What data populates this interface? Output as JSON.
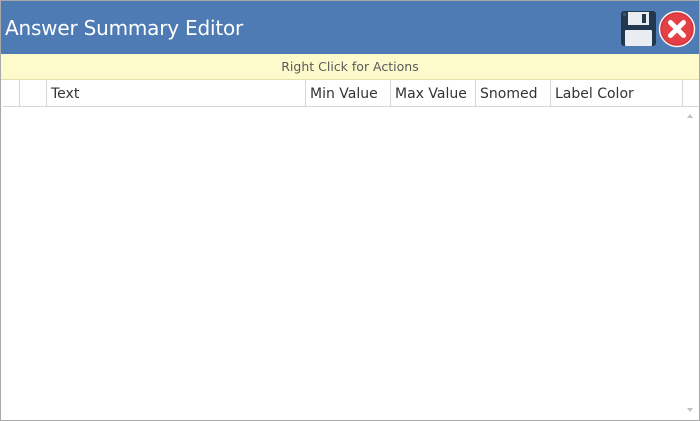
{
  "window": {
    "title": "Answer Summary Editor"
  },
  "toolbar": {
    "save_icon": "floppy-disk-icon",
    "close_icon": "close-circle-icon"
  },
  "hint": {
    "text": "Right Click for Actions"
  },
  "grid": {
    "columns": [
      "",
      "",
      "Text",
      "Min Value",
      "Max Value",
      "Snomed",
      "Label Color",
      ""
    ],
    "rows": []
  },
  "colors": {
    "titlebar": "#4f7bb4",
    "hint_background": "#fdfacb",
    "close_red": "#e0353a"
  }
}
